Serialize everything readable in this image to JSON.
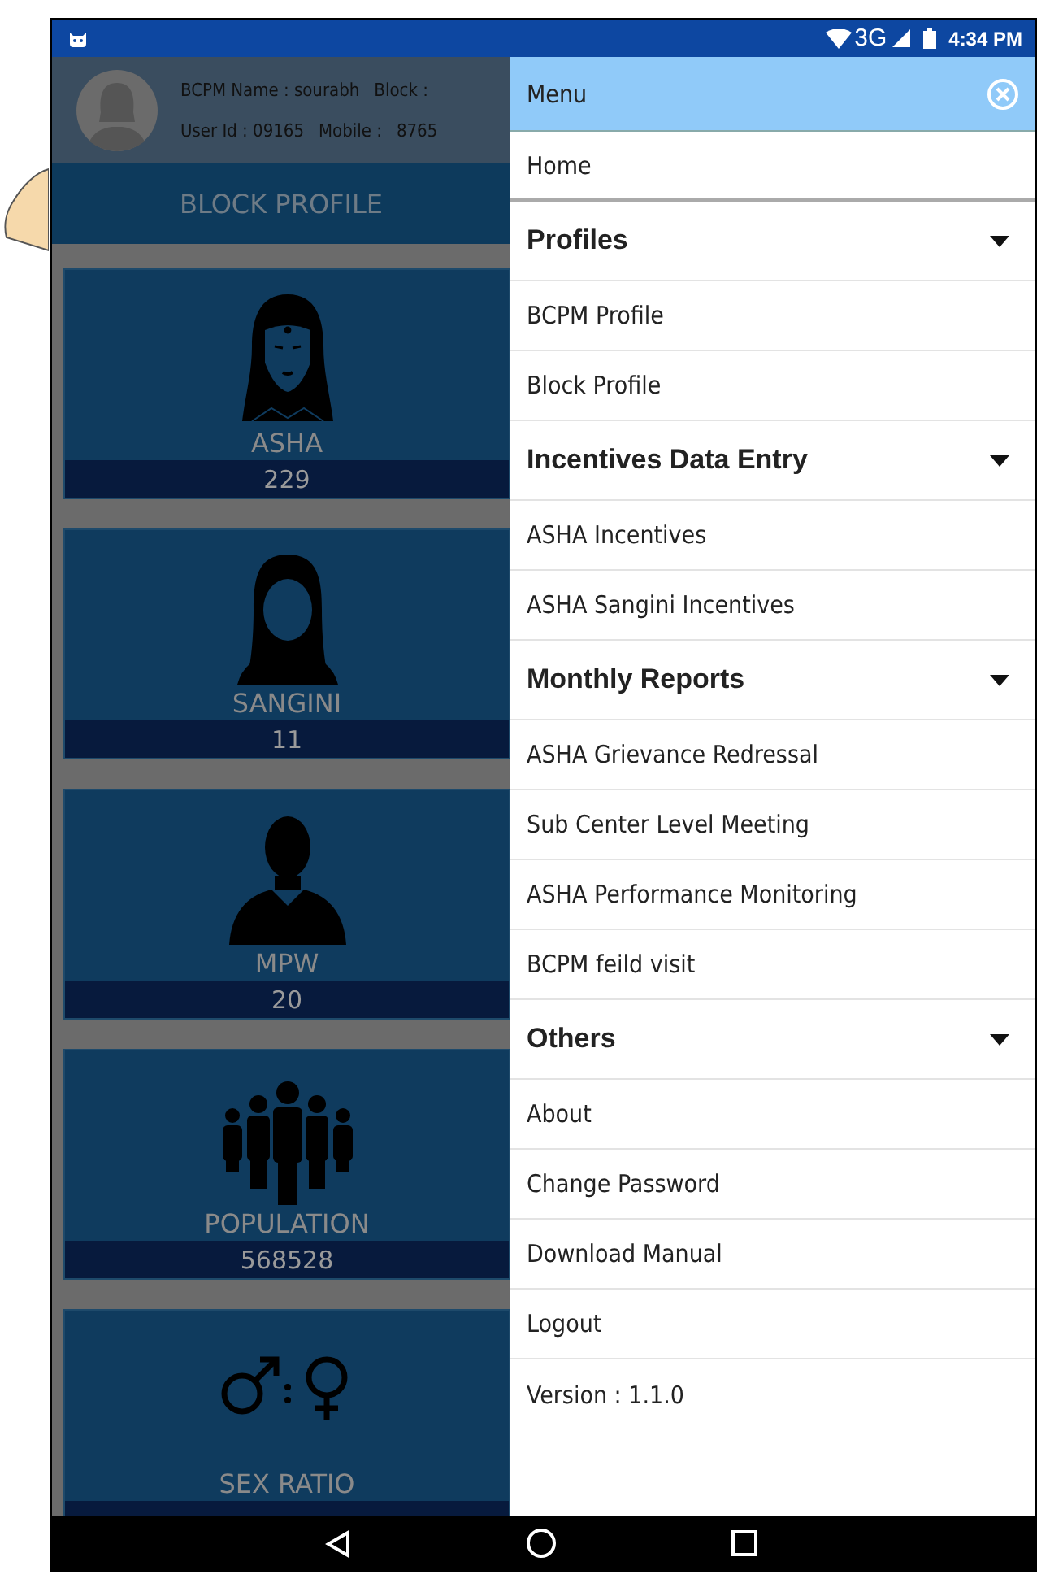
{
  "status_bar": {
    "network": "3G",
    "time": "4:34 PM"
  },
  "profile": {
    "name_line": [
      {
        "text": "BCPM Name : sourabh"
      },
      {
        "text": "Block :"
      }
    ],
    "id_line": [
      {
        "text": "User Id : 09165"
      },
      {
        "text": "Mobile :"
      },
      {
        "text": "8765"
      }
    ]
  },
  "section_title": "BLOCK PROFILE",
  "tiles": [
    {
      "kind": "asha",
      "label": "ASHA",
      "count": "229"
    },
    {
      "kind": "sangini",
      "label": "SANGINI",
      "count": "11"
    },
    {
      "kind": "mpw",
      "label": "MPW",
      "count": "20"
    },
    {
      "kind": "population",
      "label": "POPULATION",
      "count": "568528"
    },
    {
      "kind": "sex_ratio",
      "label": "SEX RATIO"
    }
  ],
  "drawer": {
    "title": "Menu",
    "items": [
      {
        "kind": "item",
        "label": "Home"
      },
      {
        "kind": "section",
        "label": "Profiles",
        "expanded": true
      },
      {
        "kind": "item",
        "label": "BCPM Profile"
      },
      {
        "kind": "item",
        "label": "Block Profile"
      },
      {
        "kind": "section",
        "label": "Incentives Data Entry",
        "expanded": true
      },
      {
        "kind": "item",
        "label": "ASHA Incentives"
      },
      {
        "kind": "item",
        "label": "ASHA Sangini Incentives"
      },
      {
        "kind": "section",
        "label": "Monthly Reports",
        "expanded": true
      },
      {
        "kind": "item",
        "label": "ASHA Grievance Redressal"
      },
      {
        "kind": "item",
        "label": "Sub Center Level Meeting"
      },
      {
        "kind": "item",
        "label": "ASHA Performance Monitoring"
      },
      {
        "kind": "item",
        "label": "BCPM feild visit"
      },
      {
        "kind": "section",
        "label": "Others",
        "expanded": true
      },
      {
        "kind": "item",
        "label": "About"
      },
      {
        "kind": "item",
        "label": "Change Password"
      },
      {
        "kind": "item",
        "label": "Download Manual"
      },
      {
        "kind": "item",
        "label": "Logout"
      },
      {
        "kind": "info",
        "label": "Version : 1.1.0"
      }
    ]
  }
}
